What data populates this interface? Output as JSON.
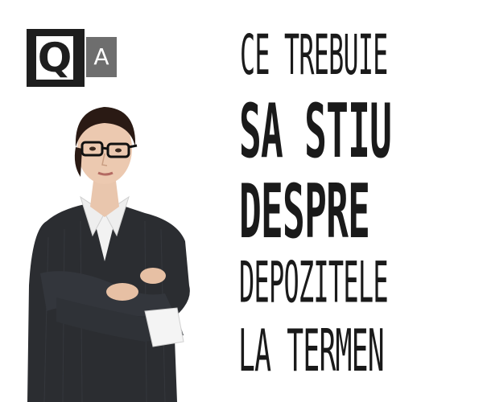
{
  "logo": {
    "q_letter": "Q",
    "a_letter": "A"
  },
  "heading": {
    "lines": [
      "CE TREBUIE",
      "SA STIU",
      "DESPRE",
      "DEPOZITELE",
      "LA TERMEN"
    ]
  },
  "colors": {
    "text": "#1a1a1a",
    "logo_dark": "#1e1e1e",
    "logo_grey": "#6e6e6e",
    "background": "#ffffff"
  }
}
